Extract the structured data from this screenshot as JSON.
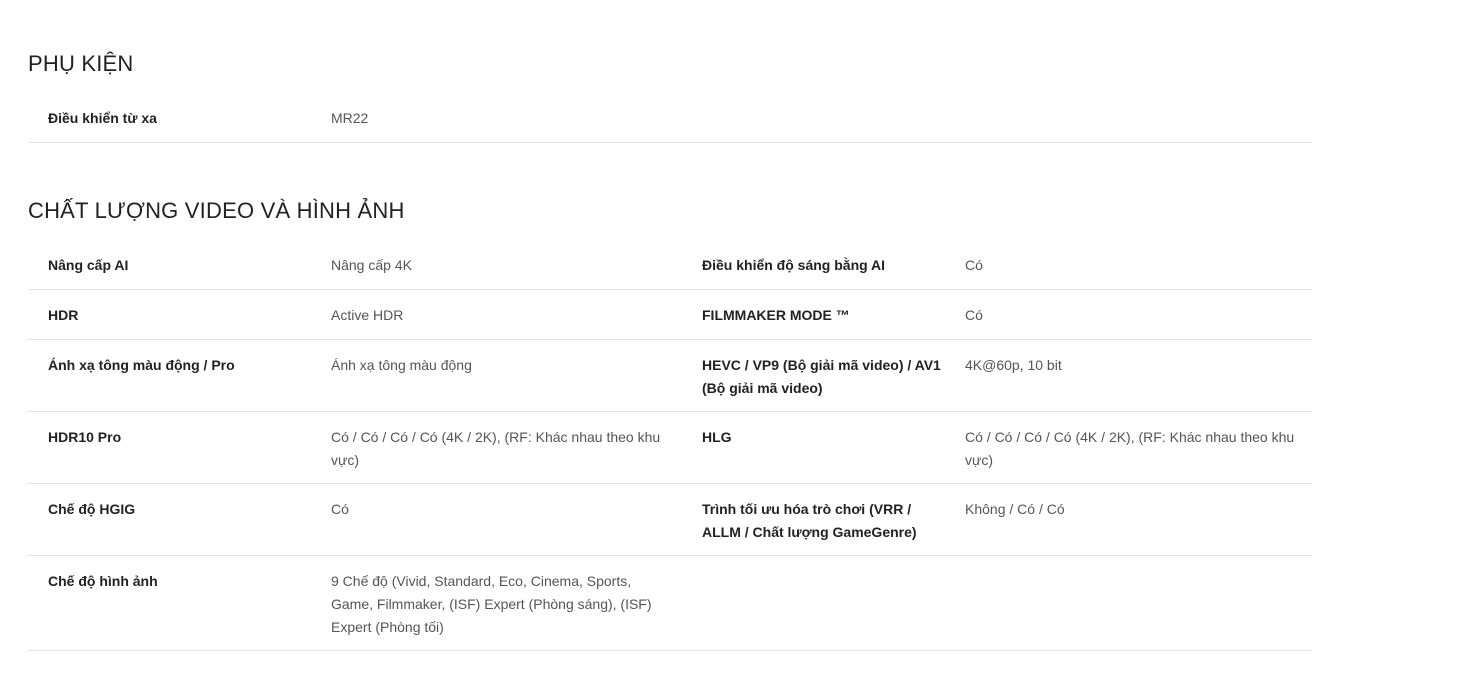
{
  "sections": [
    {
      "title": "PHỤ KIỆN",
      "rows": [
        {
          "label1": "Điều khiển từ xa",
          "value1": "MR22",
          "label2": "",
          "value2": ""
        }
      ]
    },
    {
      "title": "CHẤT LƯỢNG VIDEO VÀ HÌNH ẢNH",
      "rows": [
        {
          "label1": "Nâng cấp AI",
          "value1": "Nâng cấp 4K",
          "label2": "Điều khiển độ sáng bằng AI",
          "value2": "Có"
        },
        {
          "label1": "HDR",
          "value1": "Active HDR",
          "label2": "FILMMAKER MODE ™",
          "value2": "Có"
        },
        {
          "label1": "Ánh xạ tông màu động / Pro",
          "value1": "Ánh xạ tông màu động",
          "label2": "HEVC / VP9 (Bộ giải mã video) / AV1 (Bộ giải mã video)",
          "value2": "4K@60p, 10 bit"
        },
        {
          "label1": "HDR10 Pro",
          "value1": "Có / Có / Có / Có (4K / 2K), (RF: Khác nhau theo khu vực)",
          "label2": "HLG",
          "value2": "Có / Có / Có / Có (4K / 2K), (RF: Khác nhau theo khu vực)"
        },
        {
          "label1": "Chế độ HGIG",
          "value1": "Có",
          "label2": "Trình tối ưu hóa trò chơi (VRR / ALLM / Chất lượng GameGenre)",
          "value2": "Không / Có / Có"
        },
        {
          "label1": "Chế độ hình ảnh",
          "value1": "9 Chế độ (Vivid, Standard, Eco, Cinema, Sports, Game, Filmmaker, (ISF) Expert (Phòng sáng), (ISF) Expert (Phòng tối)",
          "label2": "",
          "value2": ""
        }
      ]
    }
  ]
}
